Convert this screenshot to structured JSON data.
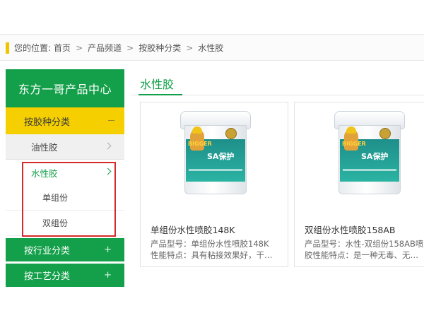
{
  "breadcrumb": {
    "prefix": "您的位置:",
    "items": [
      "首页",
      "产品频道",
      "按胶种分类",
      "水性胶"
    ],
    "separator": ">"
  },
  "sidebar": {
    "title": "东方一哥产品中心",
    "category_active": "按胶种分类",
    "subcategories": [
      {
        "label": "油性胶"
      },
      {
        "label": "水性胶"
      }
    ],
    "leaf_items": [
      "单组份",
      "双组份"
    ],
    "categories_other": [
      {
        "label": "按行业分类",
        "toggle": "+"
      },
      {
        "label": "按工艺分类",
        "toggle": "+"
      }
    ],
    "highlight_color": "#d42a2a"
  },
  "main": {
    "title": "水性胶",
    "products": [
      {
        "name": "单组份水性喷胶148K",
        "model_line": "产品型号：单组份水性喷胶148K",
        "feature_line": "性能特点：具有粘接效果好，干…"
      },
      {
        "name": "双组份水性喷胶158AB",
        "model_line": "产品型号：水性-双组份158AB喷",
        "feature_line": "胶性能特点：是一种无毒、无…"
      }
    ],
    "image_brand": "BIGGER",
    "image_text": "SA保护"
  },
  "colors": {
    "brand_green": "#14a04a",
    "accent_yellow": "#f5cf00"
  }
}
